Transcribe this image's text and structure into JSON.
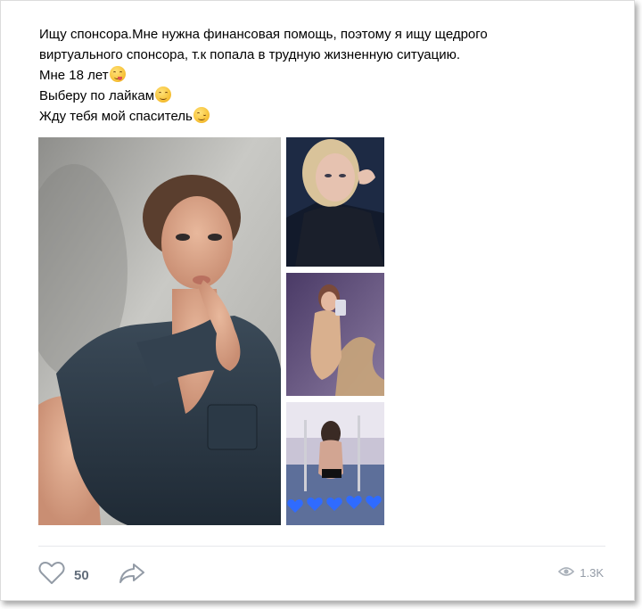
{
  "post": {
    "text_lines": [
      "Ищу спонсора.Мне нужна финансовая помощь, поэтому я ищу щедрого",
      "виртуального спонсора, т.к попала в трудную жизненную ситуацию.",
      "Мне 18 лет",
      "Выберу по лайкам",
      "Жду тебя мой спаситель"
    ],
    "emojis": [
      "face-savoring-food-emoji",
      "relieved-face-emoji",
      "winking-face-emoji"
    ]
  },
  "photos": [
    {
      "name": "photo-main",
      "subject": "woman in dark denim shirt against grey wall"
    },
    {
      "name": "photo-1",
      "subject": "blonde woman selfie in dark jacket"
    },
    {
      "name": "photo-2",
      "subject": "mirror selfie in beige bodysuit"
    },
    {
      "name": "photo-3",
      "subject": "woman by pool with blue hearts"
    }
  ],
  "footer": {
    "like_icon": "heart-icon",
    "like_count": "50",
    "share_icon": "share-arrow-icon",
    "views_icon": "eye-icon",
    "views_count": "1.3K"
  },
  "colors": {
    "text": "#000000",
    "muted": "#939ba6",
    "count": "#626d7a",
    "divider": "#e7e8ec",
    "heart_blue": "#2f6bff"
  }
}
